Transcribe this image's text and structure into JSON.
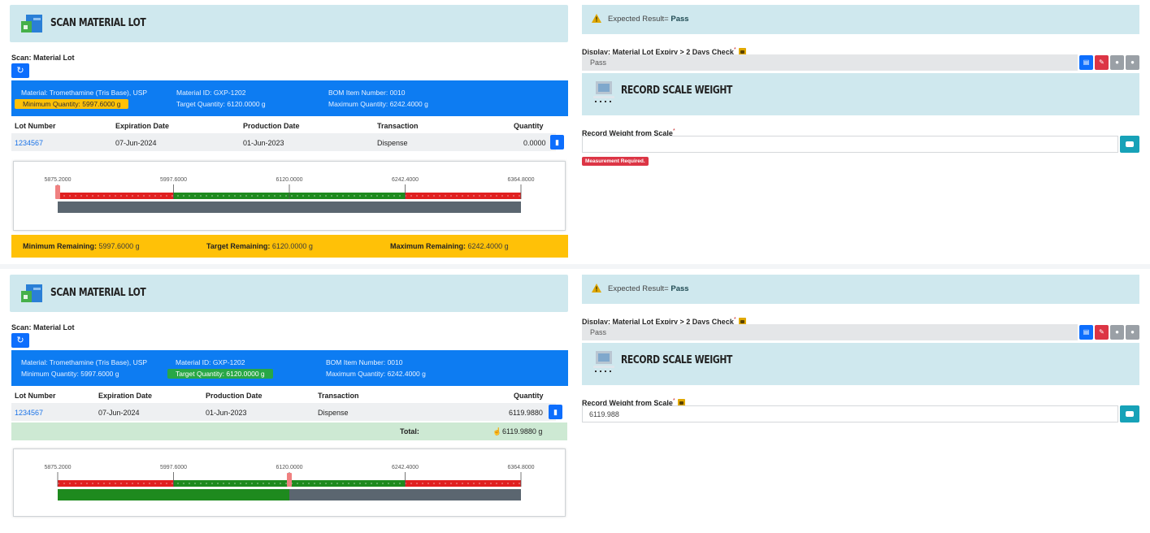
{
  "panels": [
    {
      "header_title": "SCAN MATERIAL LOT",
      "scan_label": "Scan: Material Lot",
      "info": {
        "material": "Material: Tromethamine (Tris Base), USP",
        "material_id": "Material ID: GXP-1202",
        "bom": "BOM Item Number: 0010",
        "min_qty": "Minimum Quantity: 5997.6000 g",
        "target_qty": "Target Quantity: 6120.0000 g",
        "max_qty": "Maximum Quantity: 6242.4000 g"
      },
      "columns": [
        "Lot Number",
        "Expiration Date",
        "Production Date",
        "Transaction",
        "Quantity"
      ],
      "row": [
        "1234567",
        "07-Jun-2024",
        "01-Jun-2023",
        "Dispense",
        "0.0000"
      ],
      "scale": {
        "ticks": [
          "5875.2000",
          "5997.6000",
          "6120.0000",
          "6242.4000",
          "6364.8000"
        ],
        "fill_fraction": 0.0,
        "marker_fraction": 0.0
      },
      "footer": {
        "min_label": "Minimum Remaining:",
        "min_value": "5997.6000 g",
        "target_label": "Target Remaining:",
        "target_value": "6120.0000 g",
        "max_label": "Maximum Remaining:",
        "max_value": "6242.4000 g"
      },
      "expected": {
        "prefix": "Expected Result=",
        "value": "Pass"
      },
      "display_label": "Display: Material Lot Expiry > 2 Days Check",
      "display_required": "*",
      "display_value": "Pass",
      "record_title": "RECORD SCALE WEIGHT",
      "weight_label": "Record Weight from Scale",
      "weight_required": "*",
      "weight_value": "",
      "error_badge": "Measurement Required."
    },
    {
      "header_title": "SCAN MATERIAL LOT",
      "scan_label": "Scan: Material Lot",
      "info": {
        "material": "Material: Tromethamine (Tris Base), USP",
        "material_id": "Material ID: GXP-1202",
        "bom": "BOM Item Number: 0010",
        "min_qty": "Minimum Quantity: 5997.6000 g",
        "target_qty": "Target Quantity: 6120.0000 g",
        "max_qty": "Maximum Quantity: 6242.4000 g"
      },
      "columns": [
        "Lot Number",
        "Expiration Date",
        "Production Date",
        "Transaction",
        "Quantity"
      ],
      "row": [
        "1234567",
        "07-Jun-2024",
        "01-Jun-2023",
        "Dispense",
        "6119.9880"
      ],
      "total": {
        "label": "Total:",
        "value": "6119.9880 g"
      },
      "scale": {
        "ticks": [
          "5875.2000",
          "5997.6000",
          "6120.0000",
          "6242.4000",
          "6364.8000"
        ],
        "fill_fraction": 0.5,
        "marker_fraction": 0.5
      },
      "expected": {
        "prefix": "Expected Result=",
        "value": "Pass"
      },
      "display_label": "Display: Material Lot Expiry > 2 Days Check",
      "display_required": "*",
      "display_value": "Pass",
      "record_title": "RECORD SCALE WEIGHT",
      "weight_label": "Record Weight from Scale",
      "weight_required": "*",
      "weight_value": "6119.988"
    }
  ],
  "colors": {
    "header_bg": "#cfe8ee",
    "info_bg": "#0d7cf2",
    "warning": "#ffc107",
    "success": "#28a745",
    "danger": "#dc3545",
    "bar_red": "#e02020",
    "bar_green": "#1e8a1e",
    "bar_gray": "#5b6670"
  },
  "icons": [
    "material-lot-icon",
    "refresh-icon",
    "trash-icon",
    "warning-icon",
    "lock-icon",
    "scale-icon",
    "calculator-icon",
    "pencil-icon",
    "circle-icon",
    "camera-icon",
    "thumbs-up-icon"
  ]
}
